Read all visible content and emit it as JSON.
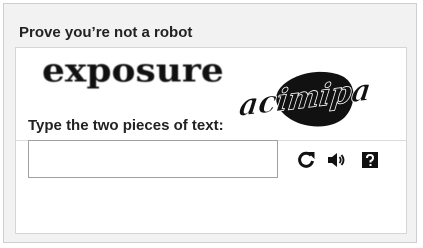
{
  "widget": {
    "title": "Prove you’re not a robot",
    "challenge_words": [
      "exposure",
      "acimipa"
    ],
    "instruction": "Type the two pieces of text:",
    "answer": {
      "value": "",
      "placeholder": ""
    },
    "controls": [
      {
        "name": "refresh",
        "icon": "refresh-icon"
      },
      {
        "name": "audio",
        "icon": "speaker-icon"
      },
      {
        "name": "help",
        "icon": "help-icon"
      }
    ]
  },
  "colors": {
    "panel_background": "#f2f2f2",
    "inner_background": "#ffffff",
    "text": "#222222",
    "captcha_ink": "#111111"
  }
}
